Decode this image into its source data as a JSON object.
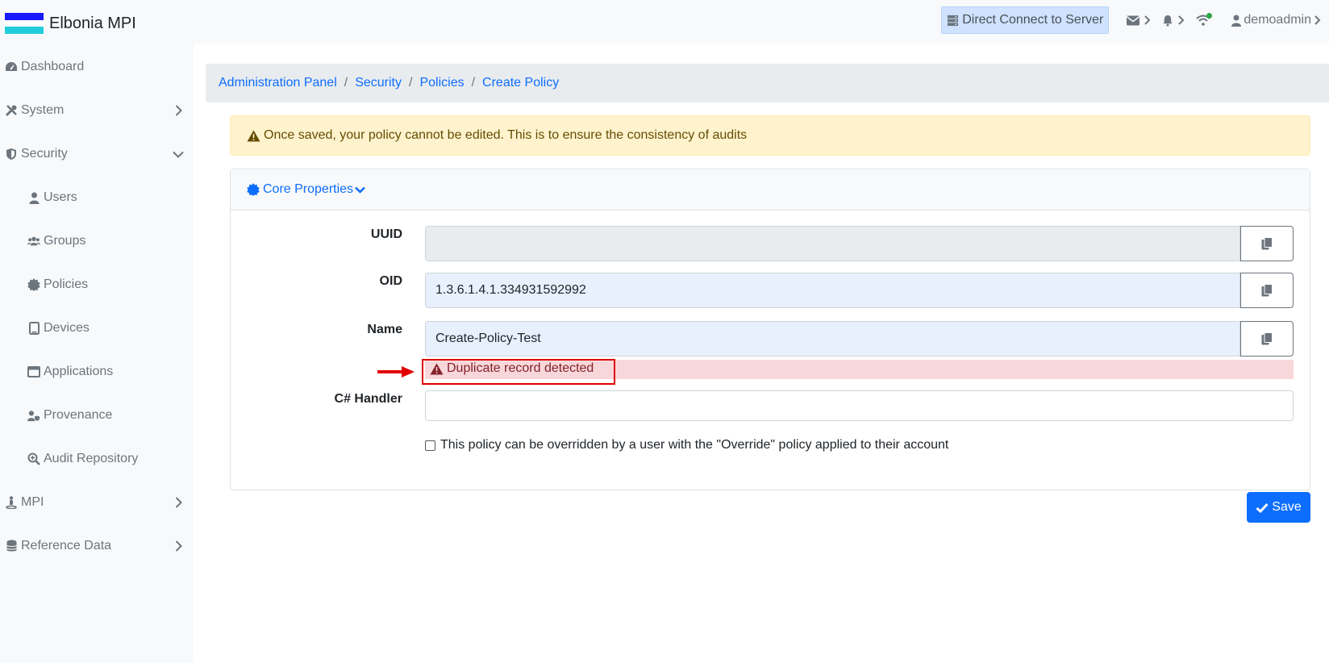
{
  "app": {
    "title": "Elbonia MPI",
    "flag_colors": [
      "#1a1aff",
      "#22ccdd"
    ]
  },
  "topnav": {
    "direct_connect_label": "Direct Connect to Server",
    "mail_icon": "envelope-icon",
    "bell_icon": "bell-icon",
    "wifi_icon": "wifi-icon",
    "user_label": "demoadmin"
  },
  "sidebar": {
    "items": [
      {
        "label": "Dashboard",
        "icon": "dashboard-icon",
        "expandable": false
      },
      {
        "label": "System",
        "icon": "tools-icon",
        "expandable": true,
        "expanded": false
      },
      {
        "label": "Security",
        "icon": "shield-icon",
        "expandable": true,
        "expanded": true
      },
      {
        "label": "Users",
        "icon": "user-icon",
        "sub": true
      },
      {
        "label": "Groups",
        "icon": "users-icon",
        "sub": true
      },
      {
        "label": "Policies",
        "icon": "certificate-icon",
        "sub": true
      },
      {
        "label": "Devices",
        "icon": "tablet-icon",
        "sub": true
      },
      {
        "label": "Applications",
        "icon": "window-icon",
        "sub": true
      },
      {
        "label": "Provenance",
        "icon": "user-shield-icon",
        "sub": true
      },
      {
        "label": "Audit Repository",
        "icon": "search-plus-icon",
        "sub": true
      },
      {
        "label": "MPI",
        "icon": "person-icon",
        "expandable": true,
        "expanded": false
      },
      {
        "label": "Reference Data",
        "icon": "database-icon",
        "expandable": true,
        "expanded": false
      }
    ]
  },
  "breadcrumb": [
    "Administration Panel",
    "Security",
    "Policies",
    "Create Policy"
  ],
  "breadcrumb_separator": "/",
  "alert": {
    "text": "Once saved, your policy cannot be edited. This is to ensure the consistency of audits"
  },
  "card": {
    "header": "Core Properties",
    "fields": {
      "uuid": {
        "label": "UUID",
        "value": ""
      },
      "oid": {
        "label": "OID",
        "value": "1.3.6.1.4.1.334931592992"
      },
      "name": {
        "label": "Name",
        "value": "Create-Policy-Test"
      },
      "handler": {
        "label": "C# Handler",
        "value": ""
      }
    },
    "error": "Duplicate record detected",
    "override_checkbox": {
      "label": "This policy can be overridden by a user with the \"Override\" policy applied to their account",
      "checked": false
    }
  },
  "save_label": "Save",
  "colors": {
    "primary": "#0d6efd",
    "error_bg": "#f8d7da",
    "highlight": "#e00000",
    "alert_bg": "#fff3cd"
  }
}
